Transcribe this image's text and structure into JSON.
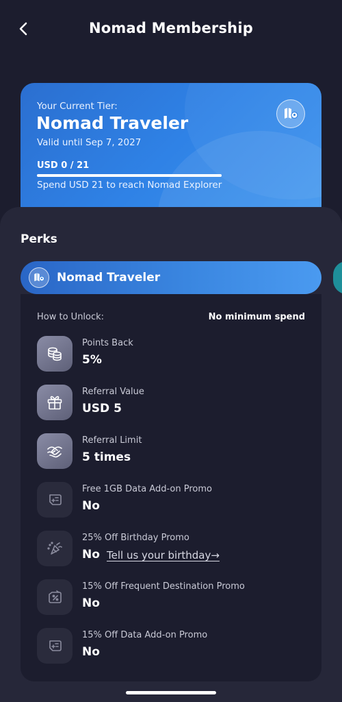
{
  "header": {
    "title": "Nomad Membership"
  },
  "tier_card": {
    "current_tier_label": "Your Current Tier:",
    "tier_name": "Nomad Traveler",
    "valid_until": "Valid until Sep 7, 2027",
    "progress_text": "USD 0 / 21",
    "progress_fraction": 0,
    "next_tier_hint": "Spend USD 21 to reach Nomad Explorer",
    "badge_icon": "map-pin-icon"
  },
  "perks": {
    "title": "Perks",
    "selected_tier_tab": "Nomad Traveler",
    "how_to_unlock_label": "How to Unlock:",
    "how_to_unlock_value": "No minimum spend",
    "items": [
      {
        "label": "Points Back",
        "value": "5%",
        "icon": "coins-icon",
        "active": true
      },
      {
        "label": "Referral Value",
        "value": "USD 5",
        "icon": "gift-icon",
        "active": true
      },
      {
        "label": "Referral Limit",
        "value": "5 times",
        "icon": "handshake-icon",
        "active": true
      },
      {
        "label": "Free 1GB Data Add-on Promo",
        "value": "No",
        "icon": "sim-card-icon",
        "active": false
      },
      {
        "label": "25% Off Birthday Promo",
        "value": "No",
        "icon": "party-popper-icon",
        "active": false,
        "link": "Tell us your birthday→"
      },
      {
        "label": "15% Off Frequent Destination Promo",
        "value": "No",
        "icon": "percent-tag-icon",
        "active": false
      },
      {
        "label": "15% Off Data Add-on Promo",
        "value": "No",
        "icon": "sim-card-icon",
        "active": false
      }
    ]
  }
}
